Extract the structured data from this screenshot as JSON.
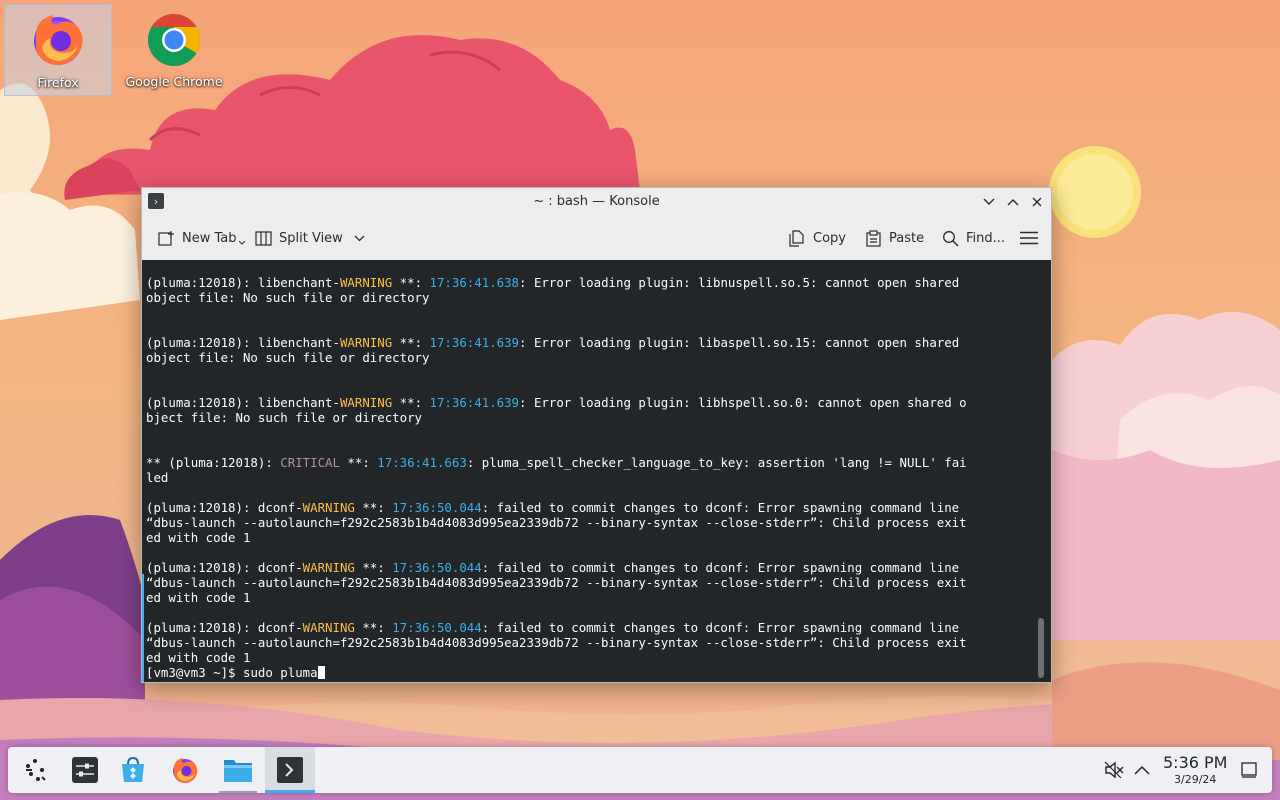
{
  "desktop": {
    "icons": [
      {
        "label": "Firefox",
        "icon": "firefox-icon"
      },
      {
        "label": "Google Chrome",
        "icon": "chrome-icon"
      }
    ]
  },
  "window": {
    "title": "~ : bash — Konsole",
    "toolbar": {
      "new_tab": "New Tab",
      "split_view": "Split View",
      "copy": "Copy",
      "paste": "Paste",
      "find": "Find..."
    }
  },
  "terminal": {
    "lines": [
      {
        "segments": [
          {
            "t": "(pluma:12018): libenchant-"
          },
          {
            "t": "WARNING",
            "c": "warn"
          },
          {
            "t": " **: "
          },
          {
            "t": "17:36:41.638",
            "c": "ts"
          },
          {
            "t": ": Error loading plugin: libnuspell.so.5: cannot open shared"
          }
        ]
      },
      {
        "segments": [
          {
            "t": "object file: No such file or directory"
          }
        ]
      },
      {
        "segments": []
      },
      {
        "segments": []
      },
      {
        "segments": [
          {
            "t": "(pluma:12018): libenchant-"
          },
          {
            "t": "WARNING",
            "c": "warn"
          },
          {
            "t": " **: "
          },
          {
            "t": "17:36:41.639",
            "c": "ts"
          },
          {
            "t": ": Error loading plugin: libaspell.so.15: cannot open shared"
          }
        ]
      },
      {
        "segments": [
          {
            "t": "object file: No such file or directory"
          }
        ]
      },
      {
        "segments": []
      },
      {
        "segments": []
      },
      {
        "segments": [
          {
            "t": "(pluma:12018): libenchant-"
          },
          {
            "t": "WARNING",
            "c": "warn"
          },
          {
            "t": " **: "
          },
          {
            "t": "17:36:41.639",
            "c": "ts"
          },
          {
            "t": ": Error loading plugin: libhspell.so.0: cannot open shared o"
          }
        ]
      },
      {
        "segments": [
          {
            "t": "bject file: No such file or directory"
          }
        ]
      },
      {
        "segments": []
      },
      {
        "segments": []
      },
      {
        "segments": [
          {
            "t": "** (pluma:12018): "
          },
          {
            "t": "CRITICAL",
            "c": "crit"
          },
          {
            "t": " **: "
          },
          {
            "t": "17:36:41.663",
            "c": "ts"
          },
          {
            "t": ": pluma_spell_checker_language_to_key: assertion 'lang != NULL' fai"
          }
        ]
      },
      {
        "segments": [
          {
            "t": "led"
          }
        ]
      },
      {
        "segments": []
      },
      {
        "segments": [
          {
            "t": "(pluma:12018): dconf-"
          },
          {
            "t": "WARNING",
            "c": "warn"
          },
          {
            "t": " **: "
          },
          {
            "t": "17:36:50.044",
            "c": "ts"
          },
          {
            "t": ": failed to commit changes to dconf: Error spawning command line"
          }
        ]
      },
      {
        "segments": [
          {
            "t": "“dbus-launch --autolaunch=f292c2583b1b4d4083d995ea2339db72 --binary-syntax --close-stderr”: Child process exit"
          }
        ]
      },
      {
        "segments": [
          {
            "t": "ed with code 1"
          }
        ]
      },
      {
        "segments": []
      },
      {
        "segments": [
          {
            "t": "(pluma:12018): dconf-"
          },
          {
            "t": "WARNING",
            "c": "warn"
          },
          {
            "t": " **: "
          },
          {
            "t": "17:36:50.044",
            "c": "ts"
          },
          {
            "t": ": failed to commit changes to dconf: Error spawning command line"
          }
        ]
      },
      {
        "segments": [
          {
            "t": "“dbus-launch --autolaunch=f292c2583b1b4d4083d995ea2339db72 --binary-syntax --close-stderr”: Child process exit"
          }
        ]
      },
      {
        "segments": [
          {
            "t": "ed with code 1"
          }
        ]
      },
      {
        "segments": []
      },
      {
        "segments": [
          {
            "t": "(pluma:12018): dconf-"
          },
          {
            "t": "WARNING",
            "c": "warn"
          },
          {
            "t": " **: "
          },
          {
            "t": "17:36:50.044",
            "c": "ts"
          },
          {
            "t": ": failed to commit changes to dconf: Error spawning command line"
          }
        ]
      },
      {
        "segments": [
          {
            "t": "“dbus-launch --autolaunch=f292c2583b1b4d4083d995ea2339db72 --binary-syntax --close-stderr”: Child process exit"
          }
        ]
      },
      {
        "segments": [
          {
            "t": "ed with code 1"
          }
        ]
      }
    ],
    "prompt": "[vm3@vm3 ~]$ ",
    "command": "sudo pluma"
  },
  "taskbar": {
    "items": [
      "app-launcher-icon",
      "system-settings-icon",
      "discover-icon",
      "firefox-icon",
      "dolphin-icon",
      "konsole-icon"
    ],
    "tray": [
      "volume-muted-icon",
      "tray-expand-icon",
      "show-desktop-icon"
    ],
    "clock_time": "5:36 PM",
    "clock_date": "3/29/24"
  },
  "colors": {
    "terminal_bg": "#232629",
    "terminal_fg": "#fcfcfc",
    "warning": "#fdbc4b",
    "critical": "#b48ead",
    "timestamp": "#3daee9",
    "accent": "#3daee9"
  }
}
